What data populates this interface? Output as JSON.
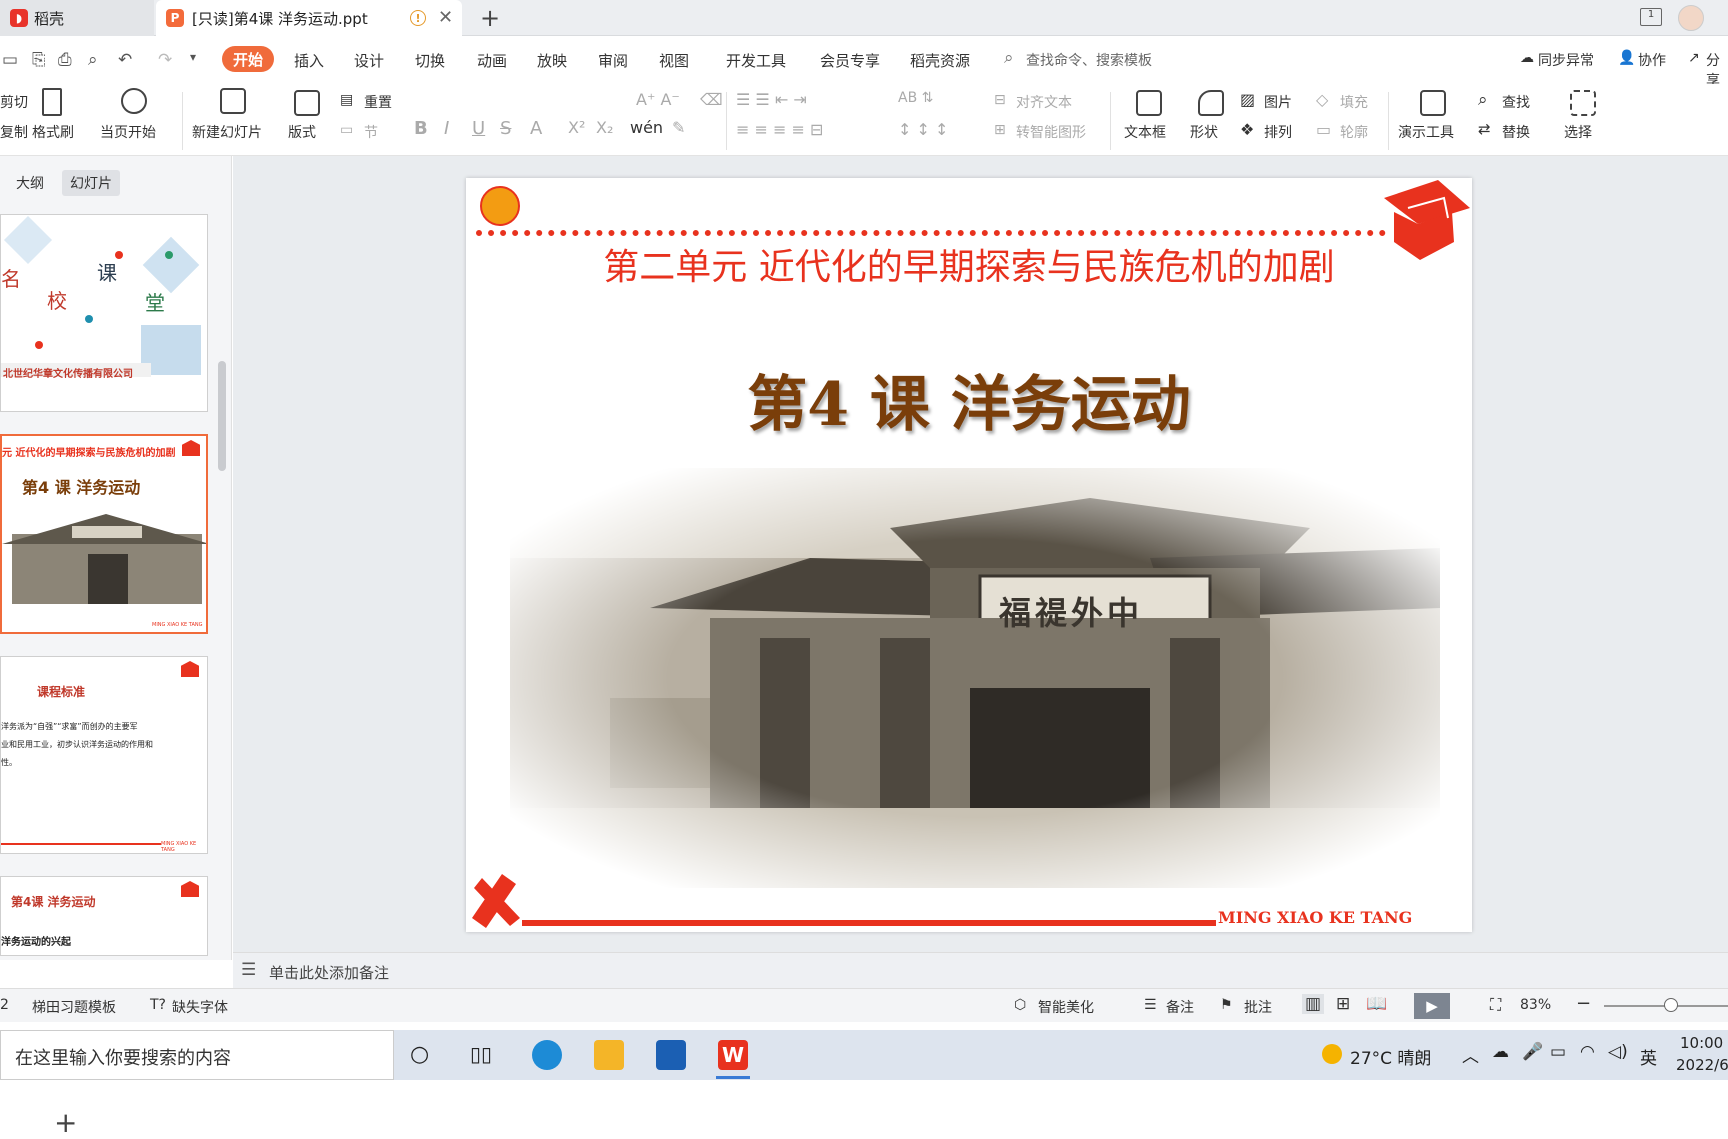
{
  "title_bar": {
    "home_tab": "稻壳",
    "doc_tab": "[只读]第4课  洋务运动.ppt",
    "window_badge": "1"
  },
  "menu": {
    "start": "开始",
    "items": [
      "插入",
      "设计",
      "切换",
      "动画",
      "放映",
      "审阅",
      "视图",
      "开发工具",
      "会员专享",
      "稻壳资源"
    ],
    "search": "查找命令、搜索模板",
    "sync": "同步异常",
    "collab": "协作",
    "share": "分享"
  },
  "ribbon": {
    "cut": "剪切",
    "copy": "复制",
    "format_painter": "格式刷",
    "play_from_current": "当页开始",
    "new_slide": "新建幻灯片",
    "layout": "版式",
    "reset": "重置",
    "section": "节",
    "align_text": "对齐文本",
    "smart_art": "转智能图形",
    "textbox": "文本框",
    "shapes": "形状",
    "picture": "图片",
    "arrange": "排列",
    "fill": "填充",
    "outline": "轮廓",
    "present_tools": "演示工具",
    "find": "查找",
    "replace": "替换",
    "select": "选择"
  },
  "panel": {
    "tab_outline": "大纲",
    "tab_slides": "幻灯片",
    "thumb1": {
      "chars": [
        "名",
        "校",
        "课",
        "堂"
      ],
      "company": "北世纪华章文化传播有限公司"
    },
    "thumb2": {
      "unit": "元  近代化的早期探索与民族危机的加剧",
      "lesson": "第4 课  洋务运动",
      "footer": "MING XIAO KE TANG"
    },
    "thumb3": {
      "heading": "课程标准",
      "lines": [
        "洋务派为“自强”“求富”而创办的主要军",
        "业和民用工业，初步认识洋务运动的作用和",
        "性。"
      ],
      "footer": "MING XIAO KE TANG"
    },
    "thumb4": {
      "lesson": "第4课   洋务运动",
      "sub": "洋务运动的兴起"
    }
  },
  "slide": {
    "unit_title": "第二单元  近代化的早期探索与民族危机的加剧",
    "lesson_title": "第4 课   洋务运动",
    "gate_plaque": "福禔外中",
    "footer": "MING XIAO KE TANG",
    "colors": {
      "red": "#e8321e",
      "brown": "#7a3e0a"
    }
  },
  "notes": {
    "placeholder": "单击此处添加备注"
  },
  "status": {
    "slide_no": "2",
    "template": "梯田习题模板",
    "missing_font": "缺失字体",
    "beautify": "智能美化",
    "notes": "备注",
    "comment": "批注",
    "zoom": "83%"
  },
  "taskbar": {
    "search": "在这里输入你要搜索的内容",
    "weather": "27°C  晴朗",
    "ime": "英",
    "time": "10:00",
    "date": "2022/6"
  }
}
